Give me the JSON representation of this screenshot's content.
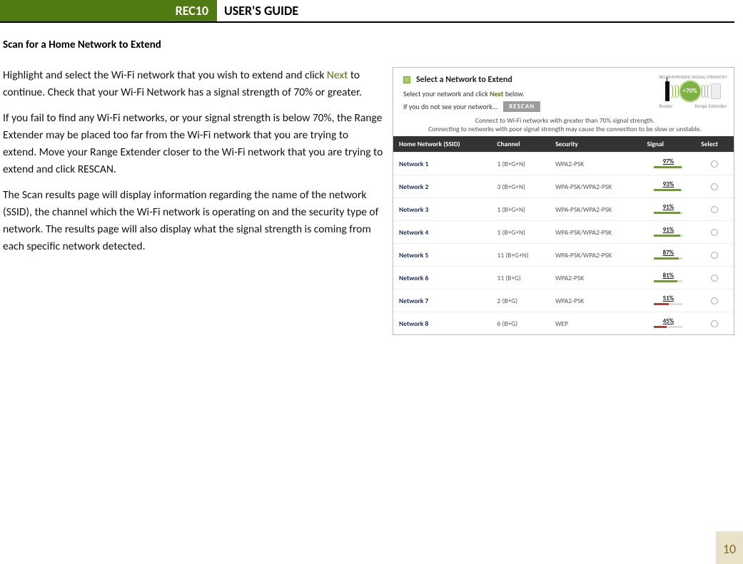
{
  "header": {
    "badge": "REC10",
    "title": "USER'S GUIDE"
  },
  "section_title": "Scan for a Home Network to Extend",
  "para1a": "Highlight and select the Wi-Fi network that you wish to extend and click ",
  "para1_next": "Next",
  "para1b": " to continue. Check that your Wi-Fi Network has a signal strength of 70% or greater.",
  "para2": "If you fail to find any Wi-Fi networks, or your signal strength is below 70%, the Range Extender may be placed too far from the Wi-Fi network that you are trying to extend.  Move your Range Extender closer to the Wi-Fi network that you are trying to extend and click RESCAN.",
  "para3": "The Scan results page will display information regarding the name of the network (SSID), the channel which the Wi-Fi network is operating on and the security type of network.  The results page will also display what the signal strength is coming from each specific network detected.",
  "figure": {
    "title": "Select a Network to Extend",
    "sub_a": "Select your network and click ",
    "sub_next": "Next",
    "sub_b": " below.",
    "nosig": "If you do not see your network...",
    "rescan": "RESCAN",
    "rec_label": "RECOMMENDED\nSIGNAL STRENGTH",
    "badge": ">70%",
    "router_label": "Router",
    "ext_label": "Range Extender",
    "note1": "Connect to Wi-Fi networks with greater than 70% signal strength.",
    "note2": "Connecting to networks with poor signal strength may cause the connection to be slow or unstable.",
    "cols": {
      "ssid": "Home Network (SSID)",
      "channel": "Channel",
      "security": "Security",
      "signal": "Signal",
      "select": "Select"
    },
    "rows": [
      {
        "ssid": "Network 1",
        "channel": "1 (B+G+N)",
        "security": "WPA2-PSK",
        "signal": 97,
        "color": "green"
      },
      {
        "ssid": "Network 2",
        "channel": "3 (B+G+N)",
        "security": "WPA-PSK/WPA2-PSK",
        "signal": 93,
        "color": "green"
      },
      {
        "ssid": "Network 3",
        "channel": "1 (B+G+N)",
        "security": "WPA-PSK/WPA2-PSK",
        "signal": 91,
        "color": "green"
      },
      {
        "ssid": "Network 4",
        "channel": "1 (B+G+N)",
        "security": "WPA-PSK/WPA2-PSK",
        "signal": 91,
        "color": "green"
      },
      {
        "ssid": "Network 5",
        "channel": "11 (B+G+N)",
        "security": "WPA-PSK/WPA2-PSK",
        "signal": 87,
        "color": "green"
      },
      {
        "ssid": "Network 6",
        "channel": "11 (B+G)",
        "security": "WPA2-PSK",
        "signal": 81,
        "color": "green"
      },
      {
        "ssid": "Network 7",
        "channel": "2 (B+G)",
        "security": "WPA2-PSK",
        "signal": 51,
        "color": "red"
      },
      {
        "ssid": "Network 8",
        "channel": "6 (B+G)",
        "security": "WEP",
        "signal": 45,
        "color": "red"
      }
    ]
  },
  "page_number": "10"
}
